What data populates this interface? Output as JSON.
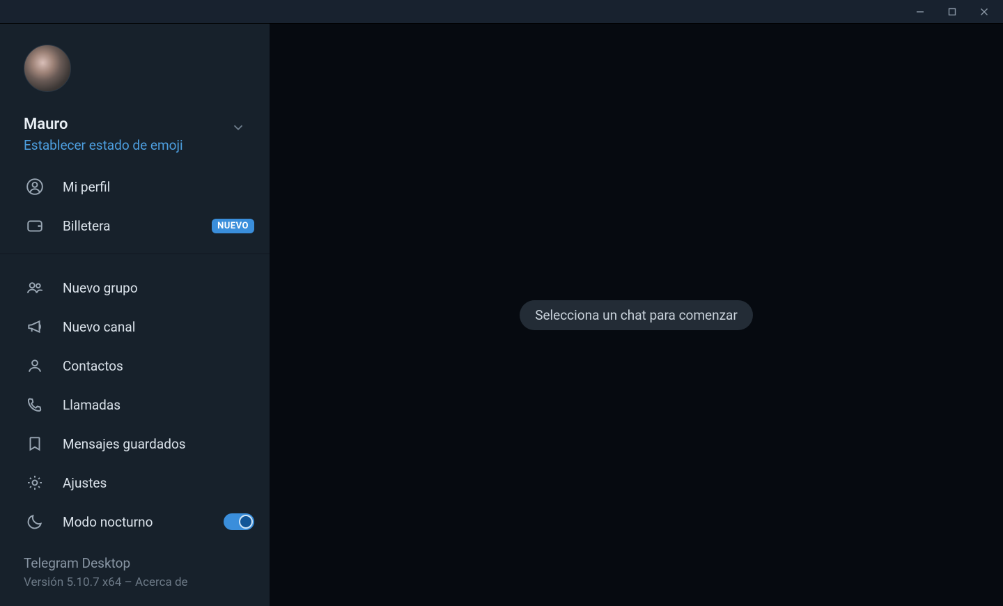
{
  "titlebar": {
    "minimize": "minimize",
    "maximize": "maximize",
    "close": "close"
  },
  "user": {
    "name": "Mauro",
    "emoji_status": "Establecer estado de emoji"
  },
  "menu": {
    "profile": "Mi perfil",
    "wallet": "Billetera",
    "wallet_badge": "NUEVO",
    "new_group": "Nuevo grupo",
    "new_channel": "Nuevo canal",
    "contacts": "Contactos",
    "calls": "Llamadas",
    "saved": "Mensajes guardados",
    "settings": "Ajustes",
    "night_mode": "Modo nocturno"
  },
  "night_mode_on": true,
  "footer": {
    "app_name": "Telegram Desktop",
    "version_prefix": "Versión 5.10.7 x64 – ",
    "about": "Acerca de"
  },
  "main": {
    "placeholder": "Selecciona un chat para comenzar"
  },
  "colors": {
    "accent": "#3a8edb",
    "sidebar_bg": "#17212b",
    "main_bg": "#060a10"
  }
}
